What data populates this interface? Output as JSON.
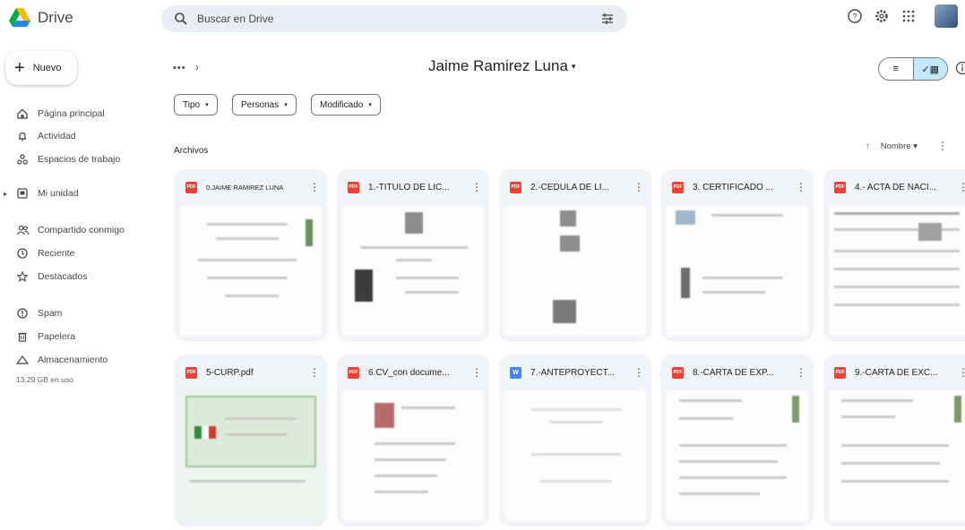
{
  "app": {
    "name": "Drive"
  },
  "search": {
    "placeholder": "Buscar en Drive"
  },
  "sidebar": {
    "new_label": "Nuevo",
    "items": [
      {
        "label": "Página principal",
        "icon": "home-icon"
      },
      {
        "label": "Actividad",
        "icon": "bell-icon"
      },
      {
        "label": "Espacios de trabajo",
        "icon": "workspaces-icon"
      },
      {
        "label": "Mi unidad",
        "icon": "my-drive-icon"
      },
      {
        "label": "Compartido conmigo",
        "icon": "people-icon"
      },
      {
        "label": "Reciente",
        "icon": "clock-icon"
      },
      {
        "label": "Destacados",
        "icon": "star-icon"
      },
      {
        "label": "Spam",
        "icon": "spam-icon"
      },
      {
        "label": "Papelera",
        "icon": "trash-icon"
      },
      {
        "label": "Almacenamiento",
        "icon": "cloud-icon"
      }
    ],
    "storage_used": "13.29 GB en uso"
  },
  "header": {
    "breadcrumb_more": "•••",
    "breadcrumb_sep": "›",
    "folder_title": "Jaime Ramirez Luna",
    "folder_arrow": "▾",
    "view_list_icon": "≡",
    "view_grid_icon": "✓▦"
  },
  "filters": [
    {
      "label": "Tipo",
      "arrow": "▾"
    },
    {
      "label": "Personas",
      "arrow": "▾"
    },
    {
      "label": "Modificado",
      "arrow": "▾"
    }
  ],
  "files_section": {
    "label": "Archivos",
    "sort_arrow": "↑",
    "sort_label": "Nombre ▾",
    "more": "⋮"
  },
  "files": [
    {
      "name": "0.JAIME RAMIREZ LUNA",
      "type": "PDF",
      "kind": "pdf"
    },
    {
      "name": "1.-TITULO DE LIC...",
      "type": "PDF",
      "kind": "pdf"
    },
    {
      "name": "2.-CEDULA DE LI...",
      "type": "PDF",
      "kind": "pdf"
    },
    {
      "name": "3. CERTIFICADO ...",
      "type": "PDF",
      "kind": "pdf"
    },
    {
      "name": "4.- ACTA DE NACI...",
      "type": "PDF",
      "kind": "pdf"
    },
    {
      "name": "5-CURP.pdf",
      "type": "PDF",
      "kind": "pdf"
    },
    {
      "name": "6.CV_con docume...",
      "type": "PDF",
      "kind": "pdf"
    },
    {
      "name": "7.-ANTEPROYECT...",
      "type": "W",
      "kind": "doc"
    },
    {
      "name": "8.-CARTA DE EXP...",
      "type": "PDF",
      "kind": "pdf"
    },
    {
      "name": "9.-CARTA DE EXC...",
      "type": "PDF",
      "kind": "pdf"
    }
  ],
  "colors": {
    "search_bg": "#e9eef6",
    "card_bg": "#f0f4f9",
    "pdf_red": "#ea4335",
    "doc_blue": "#4285f4",
    "toggle_active": "#c2e7ff"
  }
}
